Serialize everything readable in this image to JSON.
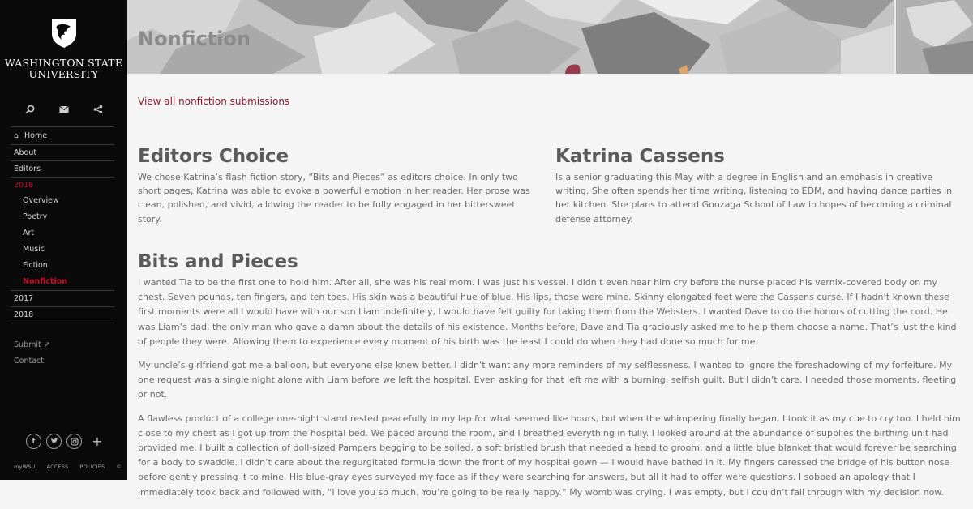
{
  "sidebar": {
    "logo": {
      "line1": "WASHINGTON STATE",
      "line2": "UNIVERSITY"
    },
    "tools": [
      "search-icon",
      "mail-icon",
      "share-icon"
    ],
    "nav": {
      "home": "Home",
      "about": "About",
      "editors": "Editors",
      "year_2016": "2016",
      "overview": "Overview",
      "poetry": "Poetry",
      "art": "Art",
      "music": "Music",
      "fiction": "Fiction",
      "nonfiction": "Nonfiction",
      "year_2017": "2017",
      "year_2018": "2018"
    },
    "submit": "Submit ↗",
    "contact": "Contact",
    "social": [
      "facebook-icon",
      "twitter-icon",
      "instagram-icon",
      "plus-icon"
    ],
    "footer_links": [
      "myWSU",
      "ACCESS",
      "POLICIES",
      "©"
    ]
  },
  "colors": {
    "accent": "#c8102e",
    "link": "#8a1b2e",
    "sidebar_bg": "#0a0a0a"
  },
  "hero": {
    "title": "Nonfiction"
  },
  "main": {
    "view_all": "View all nonfiction submissions",
    "editors_choice": {
      "title": "Editors Choice",
      "text": "We chose Katrina’s flash fiction story, “Bits and Pieces” as editors choice. In only two short pages, Katrina was able to evoke a powerful emotion in her reader. Her prose was clean, polished, and vivid, allowing the reader to be fully engaged in her bittersweet story."
    },
    "author": {
      "name": "Katrina Cassens",
      "bio": "Is a senior graduating this May with a degree in English and an emphasis in creative writing. She often spends her time writing, listening to EDM, and having dance parties in her kitchen. She plans to attend Gonzaga School of Law in hopes of becoming a criminal defense attorney."
    },
    "story": {
      "title": "Bits and Pieces",
      "paragraphs": [
        "I wanted Tia to be the first one to hold him. After all, she was his real mom. I was just his vessel. I didn’t even hear him cry before the nurse placed his vernix-covered body on my chest. Seven pounds, ten fingers, and ten toes. His skin was a beautiful hue of blue. His lips, those were mine. Skinny elongated feet were the Cassens curse. If I hadn’t known these first moments were all I would have with our son Liam indefinitely, I would have felt guilty for taking them from the Websters. I wanted Dave to do the honors of cutting the cord. He was Liam’s dad, the only man who gave a damn about the details of his existence. Months before, Dave and Tia graciously asked me to help them choose a name. That’s just the kind of people they were. Allowing them to experience every moment of his birth was the least I could do when they had done so much for me.",
        "My uncle’s girlfriend got me a balloon, but everyone else knew better. I didn’t want any more reminders of my selflessness. I wanted to ignore the foreshadowing of my forfeiture. My one request was a single night alone with Liam before we left the hospital. Even asking for that left me with a burning, selfish guilt. But I didn’t care. I needed those moments, fleeting or not.",
        "A flawless product of a college one-night stand rested peacefully in my lap for what seemed like hours, but when the whimpering finally began, I took it as my cue to cry too. I held him close to my chest as I got up from the hospital bed. We paced around the room, and I breathed everything in fully.  I looked around at the abundance of supplies the birthing unit had provided me. I built a collection of doll-sized Pampers begging to be soiled, a soft bristled brush that needed a head to groom, and a little blue blanket that would forever be searching for a body to swaddle. I didn’t care about the regurgitated formula down the front of my hospital gown — I would have bathed in it. My fingers caressed the bridge of his button nose before gently pressing it to mine. His blue-gray eyes surveyed my face as if they were searching for answers, but all it had to offer were questions. I sobbed an apology that I immediately took back and followed with, “I love you so much. You’re going to be really happy.” My womb was crying. I was empty, but I couldn’t fall through with my decision now."
      ]
    }
  }
}
